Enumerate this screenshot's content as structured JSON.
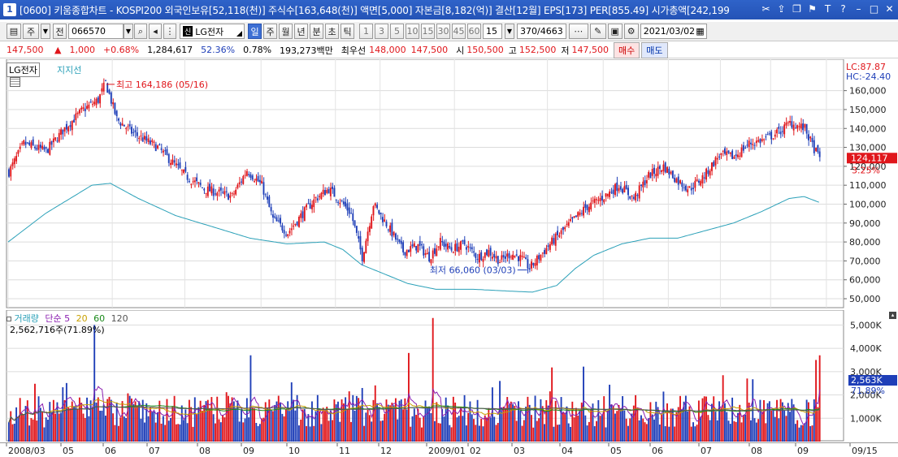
{
  "window": {
    "number": "1",
    "title": "[0600] 키움종합차트 - KOSPI200 외국인보유[52,118(천)] 주식수[163,648(천)] 액면[5,000] 자본금[8,182(억)] 결산[12월] EPS[173] PER[855.49] 시가총액[242,199"
  },
  "toolbar": {
    "type_label": "주",
    "prev_label": "전",
    "code": "066570",
    "stock_tag": "신",
    "stock_name": "LG전자",
    "periods": [
      "일",
      "주",
      "월",
      "년",
      "분",
      "초",
      "틱"
    ],
    "active_period": "일",
    "intervals": [
      "1",
      "3",
      "5",
      "10",
      "15",
      "30",
      "45",
      "60"
    ],
    "interval_value": "15",
    "count": "370",
    "total": "/4663",
    "date": "2021/03/02"
  },
  "price_bar": {
    "price": "147,500",
    "change": "1,000",
    "change_pct": "+0.68%",
    "volume": "1,284,617",
    "vol_ratio": "52.36%",
    "turnover": "0.78%",
    "amount": "193,273백만",
    "best_label": "최우선",
    "best_ask": "148,000",
    "best_bid": "147,500",
    "open_label": "시",
    "open": "150,500",
    "high_label": "고",
    "high": "152,500",
    "low_label": "저",
    "low": "147,500",
    "buy_label": "매수",
    "sell_label": "매도"
  },
  "price_pane": {
    "stock_label": "LG전자",
    "indicator_label": "지지선",
    "lc_label": "LC:87.87",
    "hc_label": "HC:-24.40",
    "current_price_tag": "124,117",
    "current_pct_tag": "3.25%",
    "high_annotation": "최고 164,186 (05/16)",
    "low_annotation": "최저 66,060 (03/03)"
  },
  "volume_pane": {
    "title": "거래량",
    "ma_label": "단순",
    "ma_periods": [
      "5",
      "20",
      "60",
      "120"
    ],
    "ma_colors": [
      "#8b1fb0",
      "#c8a000",
      "#1b8a1b",
      "#555555"
    ],
    "readout": "2,562,716주(71.89%)",
    "current_tag": "2,563K",
    "current_pct_tag": "71.89%"
  },
  "colors": {
    "up": "#e0161b",
    "down": "#1f3fb8",
    "support_line": "#2aa0b8",
    "title_bar": "#2453b6"
  },
  "chart_data": [
    {
      "type": "candlestick",
      "ylim": [
        47000,
        168000
      ],
      "y_ticks": [
        "160,000",
        "150,000",
        "140,000",
        "130,000",
        "120,000",
        "110,000",
        "100,000",
        "90,000",
        "80,000",
        "70,000",
        "60,000",
        "50,000"
      ],
      "x_ticks": [
        "2008/03",
        "05",
        "06",
        "07",
        "08",
        "09",
        "10",
        "11",
        "12",
        "2009/01",
        "02",
        "03",
        "04",
        "05",
        "06",
        "07",
        "08",
        "09",
        "09/15"
      ],
      "close_anchors": [
        [
          0,
          117000
        ],
        [
          8,
          132000
        ],
        [
          20,
          128000
        ],
        [
          30,
          140000
        ],
        [
          40,
          150000
        ],
        [
          48,
          155000
        ],
        [
          52,
          164186
        ],
        [
          58,
          145000
        ],
        [
          66,
          138000
        ],
        [
          80,
          130000
        ],
        [
          95,
          115000
        ],
        [
          105,
          108000
        ],
        [
          120,
          104000
        ],
        [
          128,
          118000
        ],
        [
          136,
          110000
        ],
        [
          142,
          92000
        ],
        [
          150,
          85000
        ],
        [
          158,
          95000
        ],
        [
          165,
          103000
        ],
        [
          172,
          108000
        ],
        [
          178,
          102000
        ],
        [
          184,
          95000
        ],
        [
          190,
          72000
        ],
        [
          196,
          100000
        ],
        [
          204,
          88000
        ],
        [
          212,
          75000
        ],
        [
          220,
          78000
        ],
        [
          226,
          72000
        ],
        [
          232,
          80000
        ],
        [
          238,
          76000
        ],
        [
          245,
          79000
        ],
        [
          252,
          72000
        ],
        [
          258,
          75000
        ],
        [
          264,
          70000
        ],
        [
          270,
          74000
        ],
        [
          276,
          71000
        ],
        [
          280,
          66060
        ],
        [
          285,
          72000
        ],
        [
          292,
          80000
        ],
        [
          300,
          88000
        ],
        [
          310,
          98000
        ],
        [
          320,
          104000
        ],
        [
          328,
          110000
        ],
        [
          336,
          103000
        ],
        [
          344,
          115000
        ],
        [
          352,
          120000
        ],
        [
          360,
          112000
        ],
        [
          366,
          108000
        ],
        [
          374,
          115000
        ],
        [
          382,
          126000
        ],
        [
          390,
          125000
        ],
        [
          398,
          132000
        ],
        [
          406,
          134000
        ],
        [
          414,
          138000
        ],
        [
          420,
          143000
        ],
        [
          428,
          140000
        ],
        [
          432,
          131000
        ],
        [
          436,
          124117
        ]
      ],
      "support_anchors": [
        [
          0,
          80000
        ],
        [
          20,
          95000
        ],
        [
          35,
          104000
        ],
        [
          45,
          110000
        ],
        [
          55,
          111000
        ],
        [
          70,
          103000
        ],
        [
          90,
          94000
        ],
        [
          110,
          88000
        ],
        [
          130,
          82000
        ],
        [
          150,
          79000
        ],
        [
          170,
          80000
        ],
        [
          180,
          76000
        ],
        [
          190,
          68000
        ],
        [
          200,
          64000
        ],
        [
          215,
          58000
        ],
        [
          230,
          55000
        ],
        [
          250,
          55000
        ],
        [
          270,
          54000
        ],
        [
          282,
          53500
        ],
        [
          295,
          57000
        ],
        [
          305,
          66000
        ],
        [
          315,
          73000
        ],
        [
          330,
          79000
        ],
        [
          345,
          82000
        ],
        [
          360,
          82000
        ],
        [
          375,
          86000
        ],
        [
          390,
          90000
        ],
        [
          405,
          96000
        ],
        [
          420,
          103000
        ],
        [
          428,
          104000
        ],
        [
          436,
          101000
        ]
      ],
      "annotations": [
        {
          "label": "최고 164,186 (05/16)",
          "index": 52,
          "value": 164186
        },
        {
          "label": "최저 66,060 (03/03)",
          "index": 280,
          "value": 66060
        }
      ]
    },
    {
      "type": "bar",
      "title": "거래량",
      "ylim": [
        0,
        5500000
      ],
      "y_ticks": [
        "5,000K",
        "4,000K",
        "3,000K",
        "2,000K",
        "1,000K"
      ],
      "spikes": [
        [
          46,
          5000000
        ],
        [
          130,
          3700000
        ],
        [
          215,
          3800000
        ],
        [
          228,
          5300000
        ],
        [
          264,
          2600000
        ],
        [
          434,
          3500000
        ],
        [
          436,
          3700000
        ],
        [
          438,
          2563000
        ]
      ]
    }
  ]
}
